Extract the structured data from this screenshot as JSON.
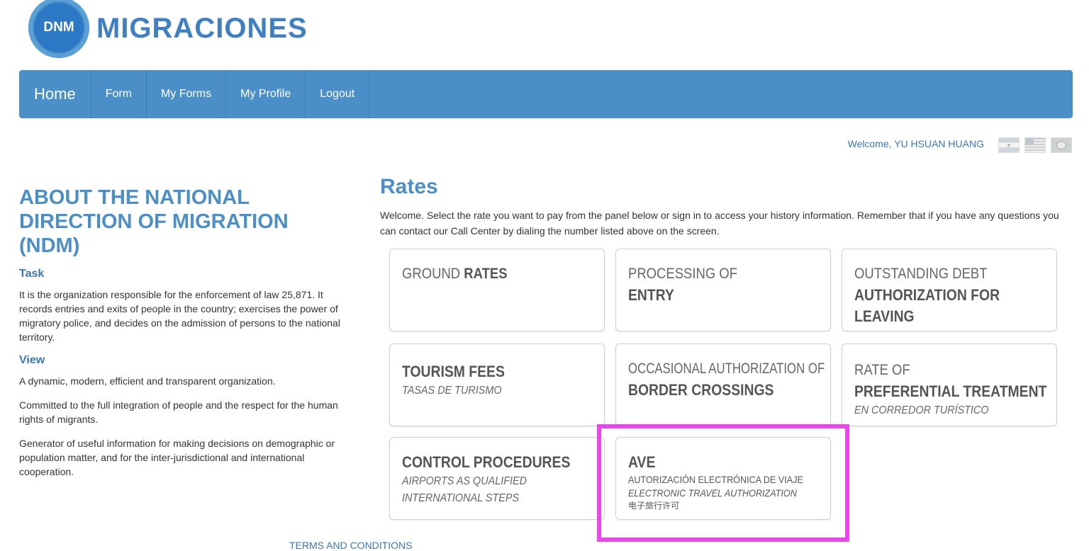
{
  "logo": {
    "abbr": "DNM",
    "name": "MIGRACIONES"
  },
  "nav": {
    "brand": "Home",
    "items": [
      "Form",
      "My Forms",
      "My Profile",
      "Logout"
    ]
  },
  "user": {
    "welcome": "Welcome, YU HSUAN HUANG",
    "languages": [
      "argentina-flag-icon",
      "usa-flag-icon",
      "brazil-flag-icon"
    ]
  },
  "about": {
    "title": "ABOUT THE NATIONAL DIRECTION OF MIGRATION (NDM)",
    "task_heading": "Task",
    "task_text": "It is the organization responsible for the enforcement of law 25,871. It records entries and exits of people in the country; exercises the power of migratory police, and decides on the admission of persons to the national territory.",
    "view_heading": "View",
    "view_paragraphs": [
      "A dynamic, modern, efficient and transparent organization.",
      "Committed to the full integration of people and the respect for the human rights of migrants.",
      "Generator of useful information for making decisions on demographic or population matter, and for the inter-jurisdictional and international cooperation."
    ]
  },
  "rates": {
    "title": "Rates",
    "intro": "Welcome. Select the rate you want to pay from the panel below or sign in to access your history information. Remember that if you have any questions you can contact our Call Center by dialing the number listed above on the screen.",
    "cards": {
      "ground": {
        "light": "GROUND ",
        "bold": "RATES"
      },
      "entry": {
        "light": "PROCESSING OF",
        "bold": "ENTRY"
      },
      "debt": {
        "light": "OUTSTANDING DEBT",
        "bold1": "AUTHORIZATION FOR",
        "bold2": "LEAVING"
      },
      "tourism": {
        "bold": "TOURISM FEES",
        "italic": "TASAS DE TURISMO"
      },
      "border": {
        "light": "OCCASIONAL AUTHORIZATION OF",
        "bold": "BORDER CROSSINGS"
      },
      "preferential": {
        "light": "RATE OF",
        "bold": "PREFERENTIAL TREATMENT",
        "italic": "EN CORREDOR TURÍSTICO"
      },
      "control": {
        "bold": "CONTROL PROCEDURES",
        "italic1": "AIRPORTS AS QUALIFIED",
        "italic2": "INTERNATIONAL STEPS"
      },
      "ave": {
        "bold": "AVE",
        "line1": "AUTORIZACIÓN ELECTRÓNICA DE VIAJE",
        "line2": "ELECTRONIC TRAVEL AUTHORIZATION",
        "line3": "电子旅行许可"
      }
    }
  },
  "footer": {
    "terms": "TERMS AND CONDITIONS"
  },
  "colors": {
    "brand_blue": "#4a8fc7",
    "highlight": "#ee44ee"
  }
}
